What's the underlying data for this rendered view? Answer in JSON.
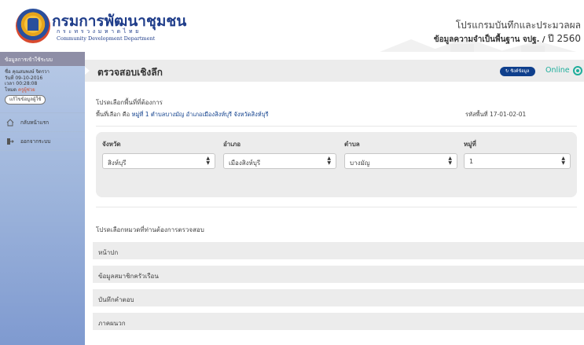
{
  "header": {
    "org_name": "กรมการพัฒนาชุมชน",
    "org_sub": "กระทรวงมหาดไทย",
    "org_en": "Community Development Department",
    "program_title": "โปรแกรมบันทึกและประมวลผล",
    "program_sub": "ข้อมูลความจำเป็นพื้นฐาน จปฐ. /",
    "program_year": "ปี 2560"
  },
  "sidebar": {
    "header_label": "ข้อมูลการเข้าใช้ระบบ",
    "user_name": "ชื่อ คุณสมพงษ์ จิตรวา",
    "login_date": "วันที่ 09-10-2016",
    "login_time": "เวลา 00:28:08",
    "role_prefix": "โหมด",
    "role_value": "ครูผู้ช่วย",
    "edit_label": "แก้ไขข้อมูลผู้ใช้",
    "items": [
      {
        "label": "กลับหน้าแรก",
        "icon": "home-icon"
      },
      {
        "label": "ออกจากระบบ",
        "icon": "logout-icon"
      }
    ]
  },
  "main": {
    "title": "ตรวจสอบเชิงลึก",
    "sync_label": "ซิงค์ข้อมูล",
    "status": "Online",
    "area_prompt": "โปรดเลือกพื้นที่ที่ต้องการ",
    "area_prefix": "พื้นที่เลือก คือ",
    "area_selected": "หมู่ที่ 1 ตำบลบางมัญ อำเภอเมืองสิงห์บุรี จังหวัดสิงห์บุรี",
    "area_code_label": "รหัสพื้นที่",
    "area_code": "17-01-02-01",
    "filters": [
      {
        "label": "จังหวัด",
        "value": "สิงห์บุรี"
      },
      {
        "label": "อำเภอ",
        "value": "เมืองสิงห์บุรี"
      },
      {
        "label": "ตำบล",
        "value": "บางมัญ"
      },
      {
        "label": "หมู่ที่",
        "value": "1"
      }
    ],
    "category_prompt": "โปรดเลือกหมวดที่ท่านต้องการตรวจสอบ",
    "categories": [
      "หน้าปก",
      "ข้อมูลสมาชิกครัวเรือน",
      "บันทึกคำตอบ",
      "ภาคผนวก"
    ]
  }
}
